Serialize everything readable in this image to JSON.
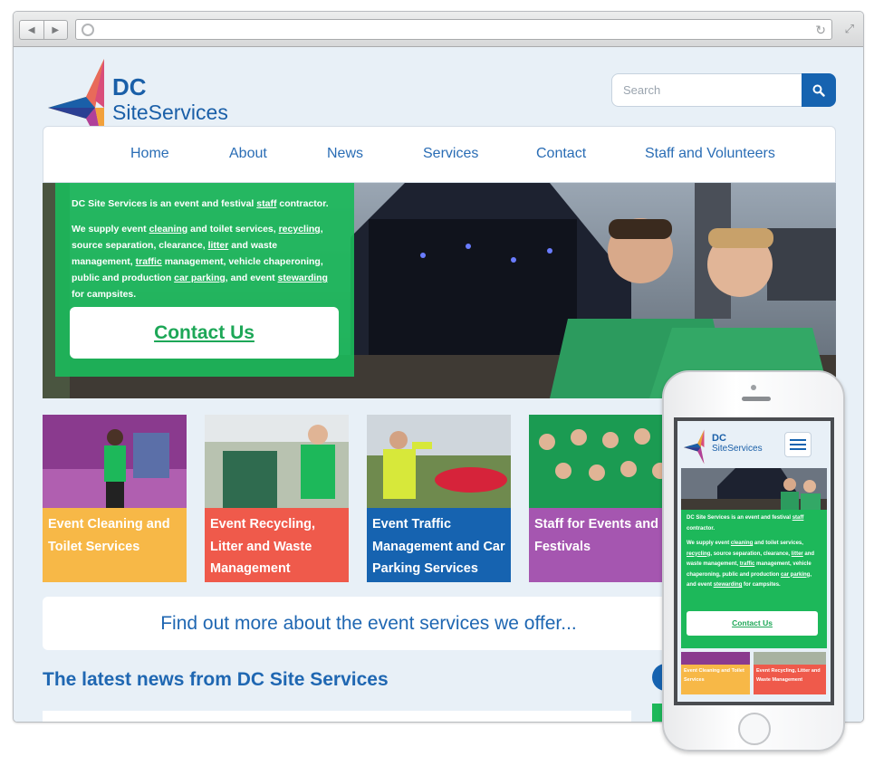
{
  "brand": {
    "line1": "DC",
    "line2": "SiteServices"
  },
  "search": {
    "placeholder": "Search"
  },
  "nav": {
    "items": [
      "Home",
      "About",
      "News",
      "Services",
      "Contact",
      "Staff and Volunteers"
    ]
  },
  "hero": {
    "intro_before": "DC Site Services is an event and festival ",
    "intro_link": "staff",
    "intro_after": " contractor.",
    "p2_a": "We supply event ",
    "p2_cleaning": "cleaning",
    "p2_b": " and toilet services, ",
    "p2_recycling": "recycling",
    "p2_c": ", source separation, clearance, ",
    "p2_litter": "litter",
    "p2_d": " and waste management, ",
    "p2_traffic": "traffic",
    "p2_e": " management, vehicle chaperoning, public and production ",
    "p2_car_parking": "car parking",
    "p2_f": ", and event ",
    "p2_stewarding": "stewarding",
    "p2_g": " for campsites.",
    "cta": "Contact Us"
  },
  "services": [
    {
      "label": "Event Cleaning and Toilet Services",
      "color": "#f7b847"
    },
    {
      "label": "Event Recycling, Litter and Waste Management",
      "color": "#ef5a4b"
    },
    {
      "label": "Event Traffic Management and Car Parking Services",
      "color": "#1663b0"
    },
    {
      "label": "Staff for Events and Festivals",
      "color": "#a556b0"
    }
  ],
  "find_more": "Find out more about the event services we offer...",
  "news_heading": "The latest news from DC Site Services",
  "colors": {
    "brand_blue": "#1a5fa8",
    "accent_green": "#1db85a",
    "page_bg": "#e8f0f7"
  },
  "mobile": {
    "brand_line1": "DC",
    "brand_line2": "SiteServices",
    "tiles": [
      {
        "label": "Event Cleaning and Toilet Services",
        "color": "#f7b847"
      },
      {
        "label": "Event Recycling, Litter and Waste Management",
        "color": "#ef5a4b"
      }
    ]
  }
}
